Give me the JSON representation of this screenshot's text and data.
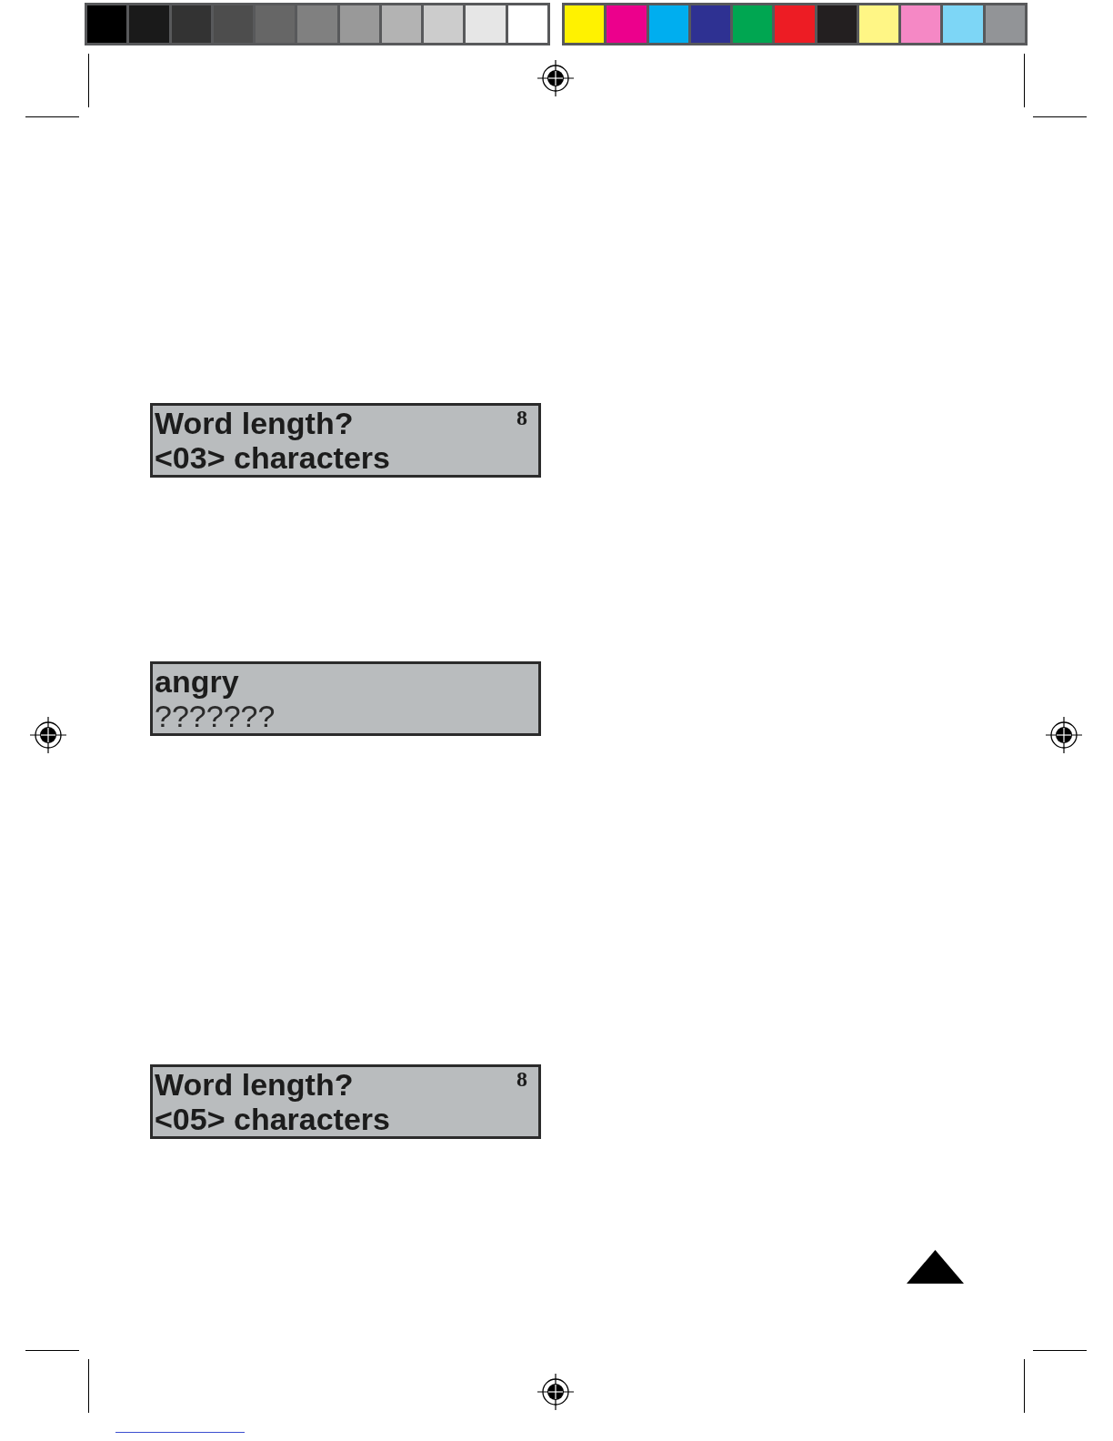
{
  "color_bars": [
    {
      "swatches": [
        {
          "color": "#000000"
        },
        {
          "color": "#1a1a1a"
        },
        {
          "color": "#333333"
        },
        {
          "color": "#4d4d4d"
        },
        {
          "color": "#666666"
        },
        {
          "color": "#808080"
        },
        {
          "color": "#999999"
        },
        {
          "color": "#b3b3b3"
        },
        {
          "color": "#cccccc"
        },
        {
          "color": "#e6e6e6"
        },
        {
          "color": "#ffffff"
        }
      ]
    },
    {
      "swatches": [
        {
          "color": "#fff200"
        },
        {
          "color": "#ec008c"
        },
        {
          "color": "#00aeef"
        },
        {
          "color": "#2e3192"
        },
        {
          "color": "#00a651"
        },
        {
          "color": "#ed1c24"
        },
        {
          "color": "#231f20"
        },
        {
          "color": "#fff685"
        },
        {
          "color": "#f588c5"
        },
        {
          "color": "#7dd6f6"
        },
        {
          "color": "#929497"
        }
      ]
    }
  ],
  "screens": [
    {
      "lines": [
        {
          "text": "Word length?",
          "bold": true
        },
        {
          "text": "<03> characters",
          "bold": true
        }
      ],
      "indicator": "8"
    },
    {
      "lines": [
        {
          "text": "angry",
          "bold": true
        },
        {
          "text": "???????",
          "bold": false
        }
      ]
    },
    {
      "lines": [
        {
          "text": "Word length?",
          "bold": true
        },
        {
          "text": "<05> characters",
          "bold": true
        }
      ],
      "indicator": "8"
    }
  ]
}
